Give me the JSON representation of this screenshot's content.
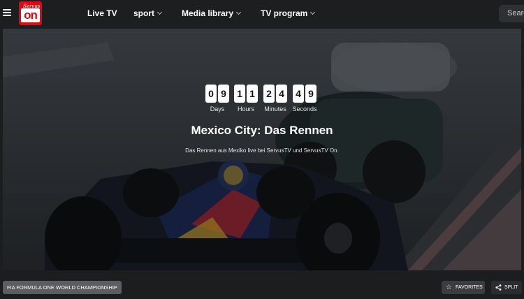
{
  "header": {
    "logo": {
      "top_text": "Servus",
      "main_text": "on"
    },
    "nav": [
      {
        "label": "Live TV",
        "dropdown": false
      },
      {
        "label": "sport",
        "dropdown": true
      },
      {
        "label": "Media library",
        "dropdown": true
      },
      {
        "label": "TV program",
        "dropdown": true
      }
    ],
    "search": {
      "placeholder": "Search"
    }
  },
  "hero": {
    "countdown": {
      "days": [
        "0",
        "9"
      ],
      "hours": [
        "1",
        "1"
      ],
      "minutes": [
        "2",
        "4"
      ],
      "seconds": [
        "4",
        "9"
      ],
      "labels": {
        "days": "Days",
        "hours": "Hours",
        "minutes": "Minutes",
        "seconds": "Seconds"
      }
    },
    "title": "Mexico City: Das Rennen",
    "subtitle": "Das Rennen aus Mexiko live bei ServusTV und ServusTV On."
  },
  "footer": {
    "category_chip": "FIA FORMULA ONE WORLD CHAMPIONSHIP",
    "favorites_label": "FAVORITES",
    "split_label": "SPLIT"
  },
  "colors": {
    "brand": "#e30613",
    "header_bg": "#1d1e20",
    "chip_bg": "#5b5d61"
  }
}
